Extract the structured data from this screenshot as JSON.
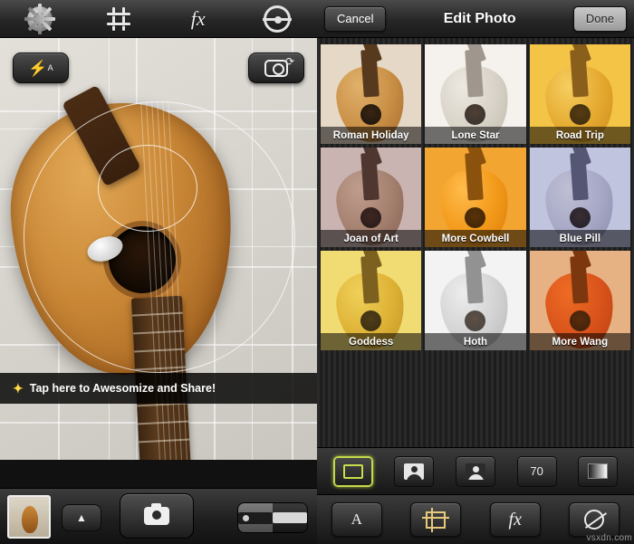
{
  "camera": {
    "toolbar": {
      "settings_icon": "gear-icon",
      "grid_icon": "grid-icon",
      "fx_label": "fx",
      "lens_icon": "lens-icon"
    },
    "flash_label": "A",
    "flash_icon": "flash-bolt-icon",
    "switch_camera_icon": "switch-camera-icon",
    "hint_text": "Tap here to Awesomize and Share!",
    "hint_icon": "sparkle-icon",
    "bottom": {
      "thumbnail_name": "last-photo-thumbnail",
      "chevron_label": "▲",
      "shutter_icon": "camera-shutter-icon",
      "mode_still_icon": "still-camera-icon",
      "mode_video_icon": "video-camera-icon"
    }
  },
  "editor": {
    "cancel_label": "Cancel",
    "title": "Edit Photo",
    "done_label": "Done",
    "filters": [
      {
        "name": "Roman Holiday",
        "bg": "#e8ded0",
        "body": "radial-gradient(ellipse at 35% 25%, #e3b26a, #c98c40 55%, #9d6326)",
        "neck": "#4a2d14",
        "tint": "rgba(210,170,120,0.10)"
      },
      {
        "name": "Lone Star",
        "bg": "#f3f0ea",
        "body": "radial-gradient(ellipse at 35% 25%, #e9e4da, #cfc8bb 55%, #b3aa9a)",
        "neck": "#8a8174",
        "tint": "rgba(255,255,255,0.18)"
      },
      {
        "name": "Road Trip",
        "bg": "#f2c64a",
        "body": "radial-gradient(ellipse at 35% 25%, #f6d26a, #e0a32c 55%, #c07c14)",
        "neck": "#6b4412",
        "tint": "rgba(245,190,60,0.22)"
      },
      {
        "name": "Joan of Art",
        "bg": "#d7c6bf",
        "body": "radial-gradient(ellipse at 35% 25%, #c9a98f, #a8846a 55%, #7e5d45)",
        "neck": "#3e2a1c",
        "tint": "rgba(150,110,130,0.20)"
      },
      {
        "name": "More Cowbell",
        "bg": "#f0a93a",
        "body": "radial-gradient(ellipse at 35% 25%, #ffc65c, #ef9a1c 55%, #cf7508)",
        "neck": "#6a3f0b",
        "tint": "rgba(255,150,20,0.22)"
      },
      {
        "name": "Blue Pill",
        "bg": "#d5d7e6",
        "body": "radial-gradient(ellipse at 35% 25%, #d3cfd8, #b4b2c4 55%, #8f8da6)",
        "neck": "#4b4a5c",
        "tint": "rgba(120,130,200,0.22)"
      },
      {
        "name": "Goddess",
        "bg": "#f2dc7a",
        "body": "radial-gradient(ellipse at 35% 25%, #f0cf5a, #d9a92c 55%, #b4821a)",
        "neck": "#5e4311",
        "tint": "rgba(240,215,90,0.20)"
      },
      {
        "name": "Hoth",
        "bg": "#efefef",
        "body": "radial-gradient(ellipse at 35% 25%, #e6e6e6, #c4c4c4 55%, #a0a0a0)",
        "neck": "#6e6e6e",
        "tint": "rgba(255,255,255,0.25)"
      },
      {
        "name": "More Wang",
        "bg": "#e6c9a6",
        "body": "radial-gradient(ellipse at 35% 25%, #f06a26, #d4491a 55%, #a83210)",
        "neck": "#5a2409",
        "tint": "rgba(230,110,30,0.25)"
      }
    ],
    "toolbar_top": {
      "items": [
        {
          "name": "frame-tool",
          "icon": "yellow-square-icon",
          "label": ""
        },
        {
          "name": "portrait-tool",
          "icon": "person-light-icon",
          "label": ""
        },
        {
          "name": "portrait-alt-tool",
          "icon": "person-dark-icon",
          "label": ""
        },
        {
          "name": "intensity-tool",
          "icon": "number-badge",
          "label": "70"
        },
        {
          "name": "gradient-tool",
          "icon": "gradient-icon",
          "label": ""
        }
      ]
    },
    "toolbar_bottom": {
      "items": [
        {
          "name": "auto-adjust-tool",
          "icon": "letter-a-icon",
          "label": "A"
        },
        {
          "name": "crop-tool",
          "icon": "crop-icon",
          "label": ""
        },
        {
          "name": "effects-tool",
          "icon": "fx-icon",
          "label": "fx"
        },
        {
          "name": "blur-tool",
          "icon": "blur-icon",
          "label": ""
        }
      ]
    }
  },
  "watermark": "vsxdn.com"
}
